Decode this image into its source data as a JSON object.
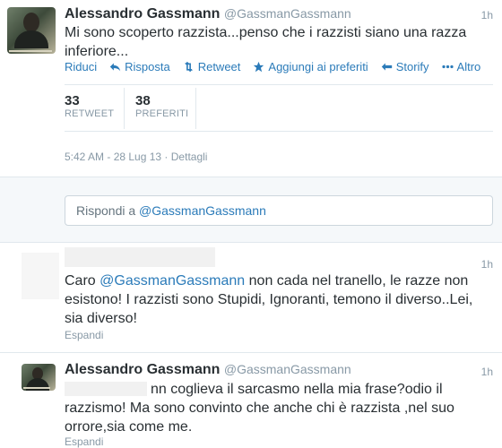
{
  "main_tweet": {
    "author_name": "Alessandro Gassmann",
    "author_handle": "@GassmanGassmann",
    "time": "1h",
    "text": "Mi sono scoperto razzista...penso che i razzisti siano una razza inferiore...",
    "actions": {
      "collapse": "Riduci",
      "reply": "Risposta",
      "retweet": "Retweet",
      "favorite": "Aggiungi ai preferiti",
      "storify": "Storify",
      "more": "Altro"
    },
    "stats": {
      "retweets_count": "33",
      "retweets_label": "RETWEET",
      "favorites_count": "38",
      "favorites_label": "PREFERITI"
    },
    "timestamp": "5:42 AM - 28 Lug 13",
    "details_link": "Dettagli"
  },
  "reply_box": {
    "prefix": "Rispondi a ",
    "mention": "@GassmanGassmann"
  },
  "reply_1": {
    "time": "1h",
    "text_prefix": "Caro ",
    "mention": "@GassmanGassmann",
    "text_rest": " non cada nel tranello, le razze non esistono! I razzisti sono Stupidi, Ignoranti, temono il diverso..Lei, sia diverso!",
    "expand": "Espandi"
  },
  "reply_2": {
    "author_name": "Alessandro Gassmann",
    "author_handle": "@GassmanGassmann",
    "time": "1h",
    "text_first_line": "nn coglieva il sarcasmo nella mia frase?odio il",
    "text_rest": "razzismo! Ma sono convinto che anche chi è razzista ,nel suo orrore,sia come me.",
    "expand": "Espandi"
  }
}
